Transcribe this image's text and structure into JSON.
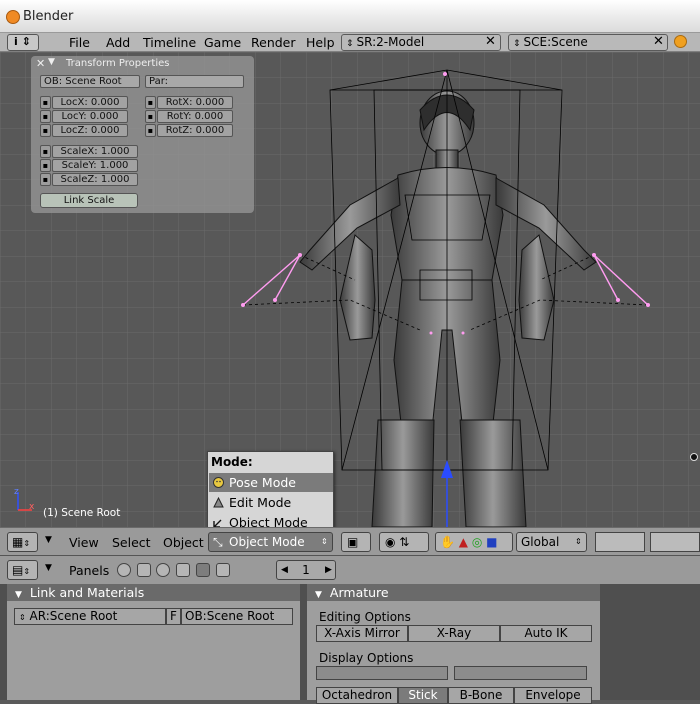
{
  "window": {
    "title": "Blender"
  },
  "menubar": {
    "items": [
      "File",
      "Add",
      "Timeline",
      "Game",
      "Render",
      "Help"
    ],
    "screen_field": "SR:2-Model",
    "scene_field": "SCE:Scene",
    "close_glyph": "✕"
  },
  "transform_panel": {
    "header": "Transform Properties",
    "object_name": "OB: Scene Root",
    "parent": "Par:",
    "loc": [
      "LocX: 0.000",
      "LocY: 0.000",
      "LocZ: 0.000"
    ],
    "rot": [
      "RotX: 0.000",
      "RotY: 0.000",
      "RotZ: 0.000"
    ],
    "scale": [
      "ScaleX: 1.000",
      "ScaleY: 1.000",
      "ScaleZ: 1.000"
    ],
    "link_scale": "Link Scale"
  },
  "viewport": {
    "status": "(1) Scene Root"
  },
  "mode_popup": {
    "header": "Mode:",
    "items": [
      "Pose Mode",
      "Edit Mode",
      "Object Mode"
    ],
    "selected": "Pose Mode"
  },
  "view_header": {
    "items": [
      "View",
      "Select",
      "Object"
    ],
    "mode_value": "Object Mode",
    "orientation": "Global"
  },
  "buttons_header": {
    "panels_label": "Panels",
    "frame": "1"
  },
  "link_materials": {
    "title": "Link and Materials",
    "armature_name": "AR:Scene Root",
    "f_label": "F",
    "object_name": "OB:Scene Root"
  },
  "armature": {
    "title": "Armature",
    "editing_label": "Editing Options",
    "editing_buttons": [
      "X-Axis Mirror",
      "X-Ray",
      "Auto IK"
    ],
    "display_label": "Display Options",
    "display_buttons": [
      "Octahedron",
      "Stick",
      "B-Bone",
      "Envelope"
    ],
    "display_selected": "Stick"
  },
  "colors": {
    "menubar": "#b7b7b7",
    "viewport_bg": "#585858",
    "grid": "#6a6a6a",
    "bone_selected": "#ff9cf0",
    "axis_blue": "#2a4cff"
  }
}
